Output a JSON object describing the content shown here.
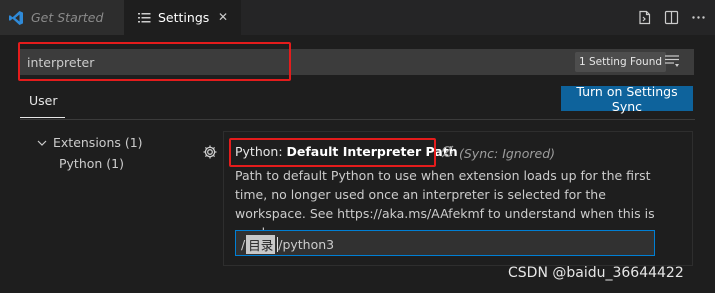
{
  "tabs": [
    {
      "label": "Get Started",
      "active": false
    },
    {
      "label": "Settings",
      "active": true
    }
  ],
  "search": {
    "value": "interpreter",
    "result_badge": "1 Setting Found"
  },
  "scope": {
    "user_tab": "User"
  },
  "sync_button": "Turn on Settings Sync",
  "tree": {
    "extensions": "Extensions (1)",
    "python": "Python (1)"
  },
  "setting": {
    "category": "Python: ",
    "name": "Default Interpreter Path",
    "sync_status": "(Sync: Ignored)",
    "description": "Path to default Python to use when extension loads up for the first time, no longer used once an interpreter is selected for the workspace. See https://aka.ms/AAfekmf to understand when this is used.",
    "value_prefix": "/",
    "value_selected": "目录",
    "value_suffix": "/python3"
  },
  "watermark": "CSDN @baidu_36644422",
  "colors": {
    "accent_button": "#0e639c",
    "highlight_box": "#e41c1c",
    "focus_border": "#007fd4"
  },
  "icons": [
    "vscode-logo-icon",
    "settings-lines-icon",
    "close-icon",
    "open-json-icon",
    "split-editor-icon",
    "more-actions-icon",
    "filter-icon",
    "chevron-down-icon",
    "gear-icon",
    "sync-ignored-icon"
  ]
}
